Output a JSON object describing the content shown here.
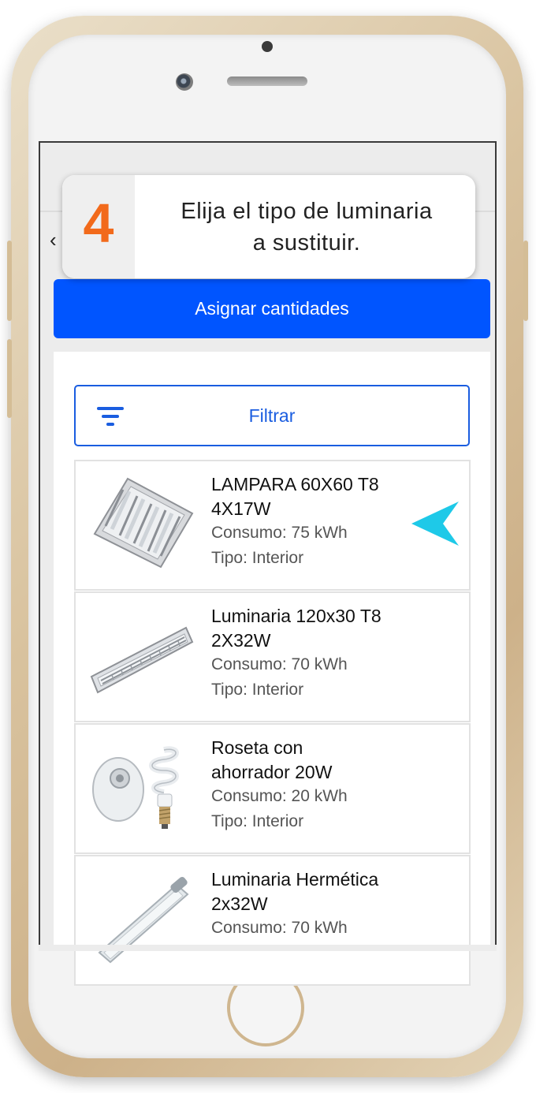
{
  "step": {
    "number": "4",
    "line1": "Elija el tipo de luminaria",
    "line2": "a sustituir."
  },
  "actions": {
    "assign_label": "Asignar cantidades",
    "filter_label": "Filtrar"
  },
  "colors": {
    "accent": "#0055ff",
    "step_number": "#f26a1b",
    "pointer": "#1ec9e8"
  },
  "items": [
    {
      "title_l1": "LAMPARA 60X60 T8",
      "title_l2": "4X17W",
      "consumo": "Consumo: 75 kWh",
      "tipo": "Tipo: Interior"
    },
    {
      "title_l1": "Luminaria 120x30 T8",
      "title_l2": "2X32W",
      "consumo": "Consumo: 70 kWh",
      "tipo": "Tipo: Interior"
    },
    {
      "title_l1": "Roseta con",
      "title_l2": "ahorrador 20W",
      "consumo": "Consumo: 20 kWh",
      "tipo": "Tipo: Interior"
    },
    {
      "title_l1": "Luminaria Hermética",
      "title_l2": "2x32W",
      "consumo": "Consumo: 70 kWh",
      "tipo": ""
    }
  ]
}
